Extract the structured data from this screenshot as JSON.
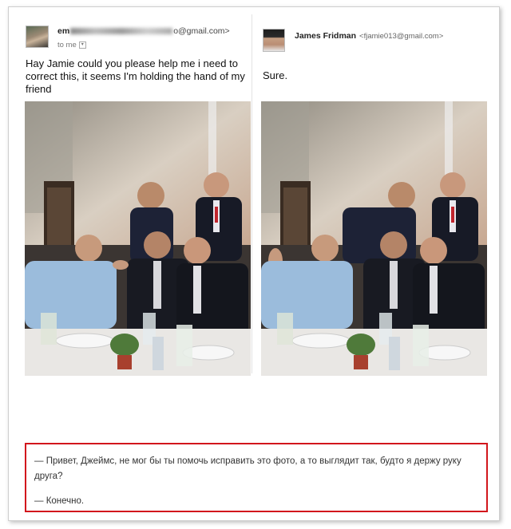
{
  "left_email": {
    "sender_prefix": "em",
    "sender_domain": "o@gmail.com>",
    "to_label": "to me",
    "message": "Hay Jamie could you please help me i need to correct this, it seems I'm holding the hand of my friend"
  },
  "right_email": {
    "sender_name": "James Fridman",
    "sender_email": "<fjamie013@gmail.com>",
    "message": "Sure."
  },
  "caption": {
    "line1": "— Привет, Джеймс, не мог бы ты помочь исправить это фото, а то выглядит так, будто я держу руку друга?",
    "line2": "— Конечно."
  },
  "colors": {
    "caption_border": "#d2161c",
    "frame_border": "#cfcfcf"
  }
}
